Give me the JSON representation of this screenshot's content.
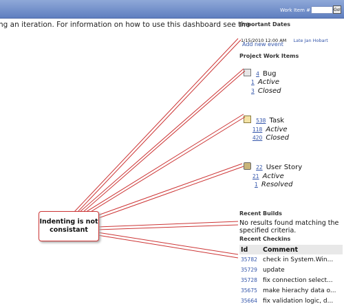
{
  "header": {
    "work_item_label": "Work Item #",
    "go_label": "Go!",
    "work_item_value": ""
  },
  "intro_text": "ng an iteration. For information on how to use this dashboard see the",
  "important_dates": {
    "title": "Important Dates",
    "date": "1/15/2010 12:00 AM",
    "event_link": "Late Jan Hobart",
    "add_link": "Add new event"
  },
  "project_work_items": {
    "title": "Project Work Items",
    "groups": [
      {
        "icon": "bug-icon",
        "count": "4",
        "type": "Bug",
        "states": [
          {
            "count": "1",
            "label": "Active"
          },
          {
            "count": "3",
            "label": "Closed"
          }
        ]
      },
      {
        "icon": "task-icon",
        "count": "538",
        "type": "Task",
        "states": [
          {
            "count": "118",
            "label": "Active"
          },
          {
            "count": "420",
            "label": "Closed"
          }
        ]
      },
      {
        "icon": "user-story-icon",
        "count": "22",
        "type": "User Story",
        "states": [
          {
            "count": "21",
            "label": "Active"
          },
          {
            "count": "1",
            "label": "Resolved"
          }
        ]
      }
    ]
  },
  "recent_builds": {
    "title": "Recent Builds",
    "message": "No results found matching the specified criteria."
  },
  "recent_checkins": {
    "title": "Recent Checkins",
    "columns": [
      "Id",
      "Comment"
    ],
    "rows": [
      {
        "id": "35782",
        "comment": "check in System.Win..."
      },
      {
        "id": "35729",
        "comment": "update"
      },
      {
        "id": "35728",
        "comment": "fix connection select..."
      },
      {
        "id": "35675",
        "comment": "make hierachy data o..."
      },
      {
        "id": "35664",
        "comment": "fix validation logic, d..."
      }
    ]
  },
  "callout": {
    "line1": "Indenting is not",
    "line2": "consistant"
  },
  "colors": {
    "header_bar": "#6f8cc8",
    "link": "#3355aa",
    "callout_border": "#cc3333"
  }
}
